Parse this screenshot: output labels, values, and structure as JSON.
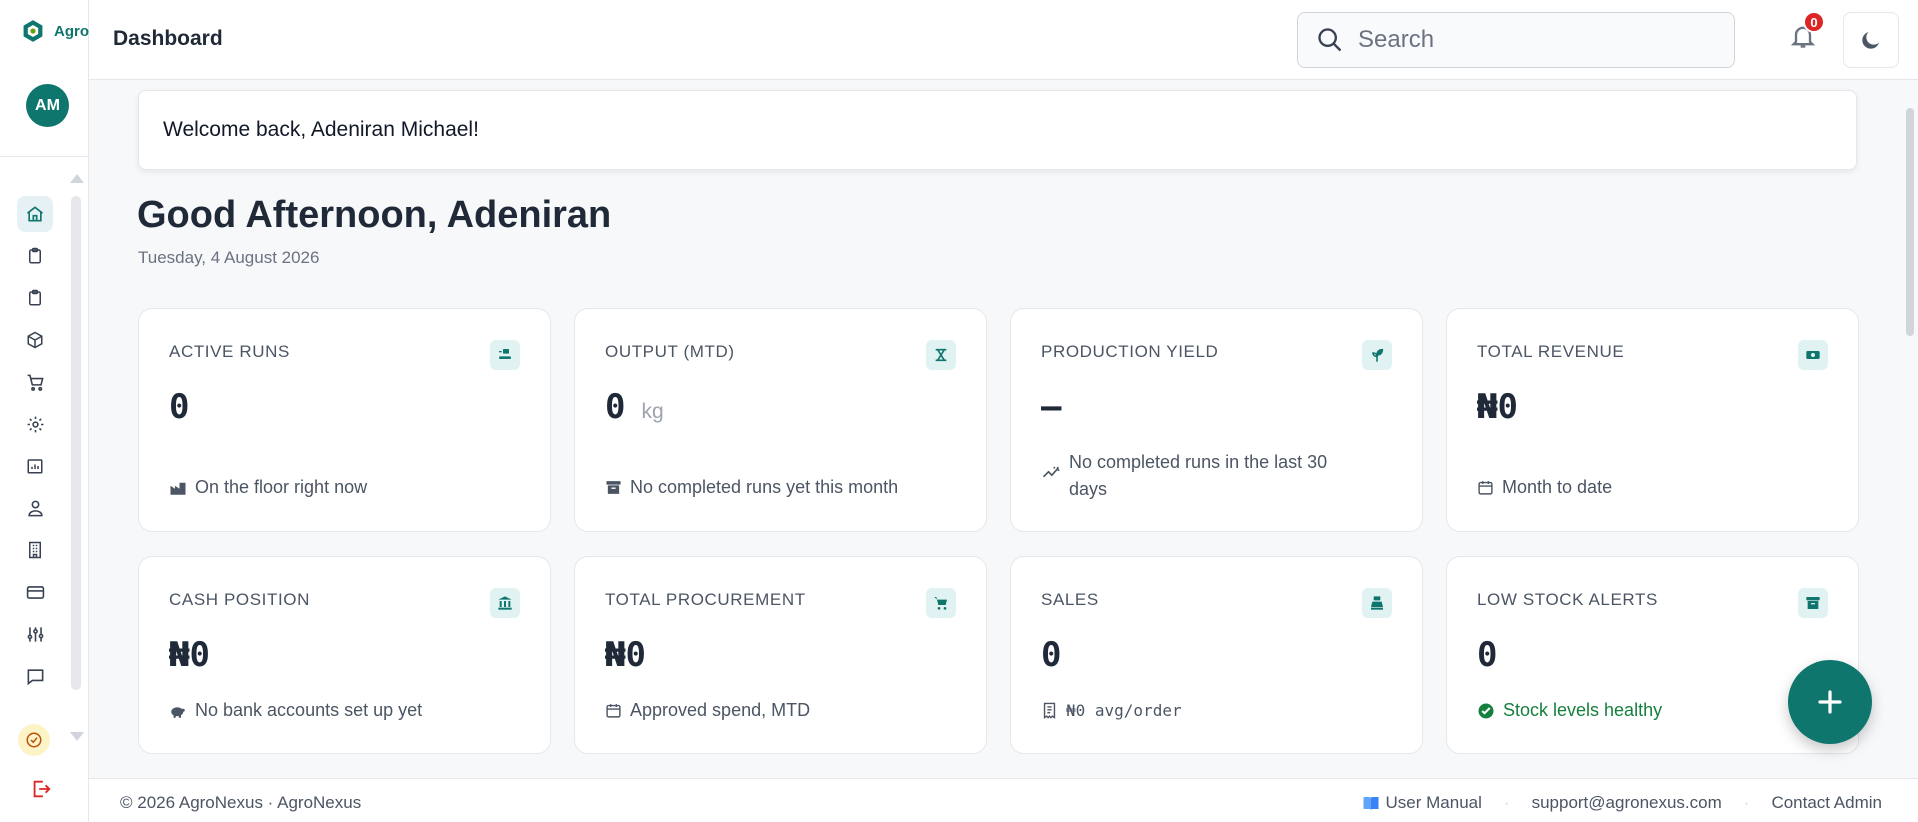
{
  "app": {
    "logo_text": "Agro",
    "avatar_initials": "AM"
  },
  "header": {
    "title": "Dashboard",
    "search_placeholder": "Search",
    "notification_count": "0"
  },
  "welcome": {
    "message": "Welcome back, Adeniran Michael!"
  },
  "greeting": {
    "title": "Good Afternoon, Adeniran",
    "date": "Tuesday, 4 August 2026"
  },
  "sidebar": {
    "items": [
      {
        "icon": "home-icon",
        "active": true
      },
      {
        "icon": "clipboard-icon"
      },
      {
        "icon": "clipboard-list-icon"
      },
      {
        "icon": "box-icon"
      },
      {
        "icon": "cart-icon"
      },
      {
        "icon": "gear-icon"
      },
      {
        "icon": "building-chart-icon"
      },
      {
        "icon": "users-icon"
      },
      {
        "icon": "office-icon"
      },
      {
        "icon": "credit-card-icon"
      },
      {
        "icon": "sliders-icon"
      },
      {
        "icon": "chat-icon"
      },
      {
        "icon": "check-clock-icon"
      }
    ]
  },
  "stats": [
    {
      "label": "ACTIVE RUNS",
      "value": "0",
      "unit": "",
      "sub": "On the floor right now",
      "icon": "conveyor-icon"
    },
    {
      "label": "OUTPUT (MTD)",
      "value": "0",
      "unit": "kg",
      "sub": "No completed runs yet this month",
      "icon": "scale-icon"
    },
    {
      "label": "PRODUCTION YIELD",
      "value": "–",
      "unit": "",
      "sub": "No completed runs in the last 30 days",
      "icon": "seedling-icon"
    },
    {
      "label": "TOTAL REVENUE",
      "value": "₦0",
      "unit": "",
      "sub": "Month to date",
      "icon": "money-icon"
    },
    {
      "label": "CASH POSITION",
      "value": "₦0",
      "unit": "",
      "sub": "No bank accounts set up yet",
      "icon": "bank-icon"
    },
    {
      "label": "TOTAL PROCUREMENT",
      "value": "₦0",
      "unit": "",
      "sub": "Approved spend, MTD",
      "icon": "cart-icon"
    },
    {
      "label": "SALES",
      "value": "0",
      "unit": "",
      "sub": "₦0 avg/order",
      "icon": "register-icon"
    },
    {
      "label": "LOW STOCK ALERTS",
      "value": "0",
      "unit": "",
      "sub": "Stock levels healthy",
      "icon": "archive-icon"
    }
  ],
  "footer": {
    "copyright": "© 2026 AgroNexus · AgroNexus",
    "manual": "User Manual",
    "email": "support@agronexus.com",
    "admin": "Contact Admin"
  },
  "colors": {
    "accent": "#0f766e",
    "danger": "#dc2626",
    "success": "#15803d"
  }
}
